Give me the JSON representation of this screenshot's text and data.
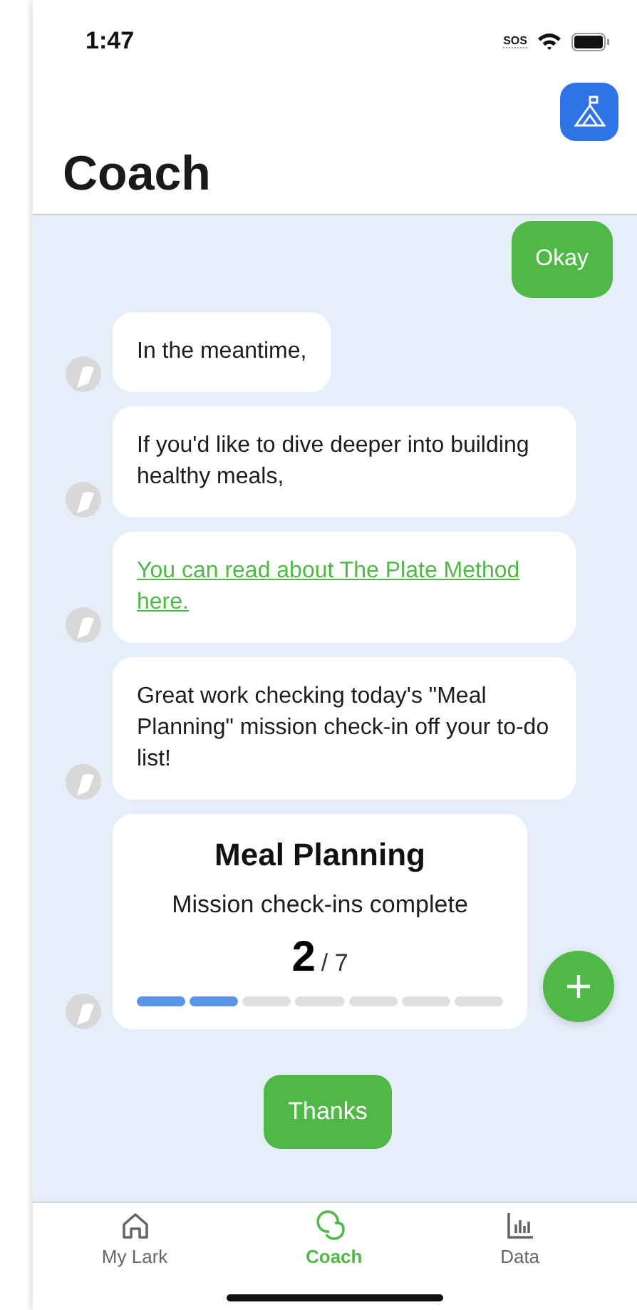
{
  "status_bar": {
    "time": "1:47",
    "sos": "SOS"
  },
  "header": {
    "title": "Coach"
  },
  "messages": [
    {
      "kind": "user",
      "text": "Okay"
    },
    {
      "kind": "coach",
      "text": "In the meantime,"
    },
    {
      "kind": "coach",
      "text": "If you'd like to dive deeper into building healthy meals,"
    },
    {
      "kind": "link",
      "text": "You can read about The Plate Method here."
    },
    {
      "kind": "coach",
      "text": "Great work checking today's \"Meal Planning\" mission check-in off your to-do list!"
    },
    {
      "kind": "progress",
      "title": "Meal Planning",
      "subtitle": "Mission check-ins complete",
      "count": "2",
      "total": "/ 7",
      "segments": [
        {
          "filled": true
        },
        {
          "filled": true
        },
        {
          "filled": false
        },
        {
          "filled": false
        },
        {
          "filled": false
        },
        {
          "filled": false
        },
        {
          "filled": false
        }
      ]
    },
    {
      "kind": "quick_reply",
      "text": "Thanks"
    }
  ],
  "tabs": [
    {
      "label": "My Lark",
      "kind": "home",
      "selected": false
    },
    {
      "label": "Coach",
      "kind": "chat",
      "selected": true
    },
    {
      "label": "Data",
      "kind": "chart",
      "selected": false
    }
  ]
}
